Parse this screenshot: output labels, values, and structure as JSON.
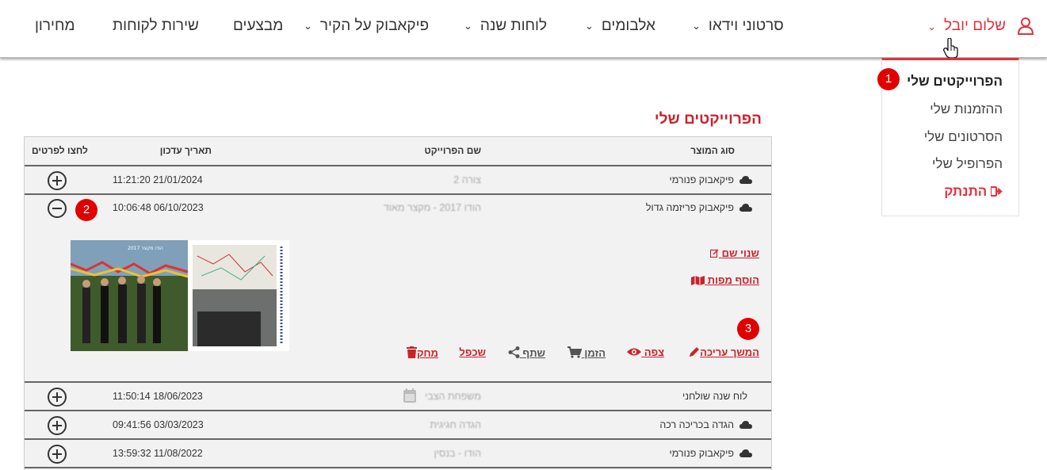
{
  "nav": {
    "items": [
      {
        "label": "מחירון"
      },
      {
        "label": "שירות לקוחות"
      },
      {
        "label": "מבצעים"
      },
      {
        "label": "פיקאבוק על הקיר"
      },
      {
        "label": "לוחות שנה"
      },
      {
        "label": "אלבומים"
      },
      {
        "label": "סרטוני וידאו"
      }
    ],
    "user_label": "שלום יובל"
  },
  "dropdown": {
    "items": [
      {
        "label": "הפרוייקטים שלי"
      },
      {
        "label": "ההזמנות שלי"
      },
      {
        "label": "הסרטונים שלי"
      },
      {
        "label": "הפרופיל שלי"
      },
      {
        "label": "התנתק"
      }
    ]
  },
  "badges": [
    "1",
    "2",
    "3"
  ],
  "page": {
    "title": "הפרוייקטים שלי"
  },
  "table": {
    "headers": {
      "product_type": "סוג המוצר",
      "project_name": "שם הפרוייקט",
      "updated": "תאריך עדכון",
      "details": "לחצו לפרטים"
    },
    "rows": [
      {
        "product": "פיקאבוק פנורמי",
        "name": "צורה 2",
        "date": "11:21:20 21/01/2024"
      },
      {
        "product": "פיקאבוק פריזמה גדול",
        "name": "הודו 2017 - מקצר מאוד",
        "date": "10:06:48 06/10/2023"
      },
      {
        "product": "לוח שנה שולחני",
        "name": "משפחת הצבי",
        "date": "11:50:14 18/06/2023"
      },
      {
        "product": "הגדה בכריכה רכה",
        "name": "הגדה חגיגית",
        "date": "09:41:56 03/03/2023"
      },
      {
        "product": "פיקאבוק פנורמי",
        "name": "הודו - בנסין",
        "date": "13:59:32 11/08/2022"
      }
    ]
  },
  "detail": {
    "rename": "שנוי שם",
    "add_maps": "הוסף מפות",
    "continue_edit": "המשך עריכה",
    "view": "צפה",
    "order": "הזמן",
    "share": "שתף",
    "duplicate": "שכפל",
    "delete": "מחק",
    "thumb_caption": "הודו מקצר 2017"
  },
  "colors": {
    "accent": "#e0333e",
    "brand_red": "#c8232c",
    "badge": "#e00000"
  }
}
